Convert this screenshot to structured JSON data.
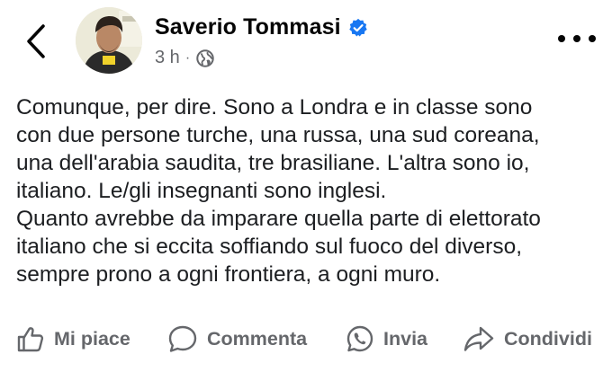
{
  "header": {
    "author_name": "Saverio Tommasi",
    "timestamp": "3 h",
    "separator": "·",
    "back_icon": "chevron-left-icon",
    "verified_icon": "verified-badge-icon",
    "privacy_icon": "globe-icon",
    "more_icon": "more-dots-icon"
  },
  "post": {
    "lines": [
      "Comunque, per dire. Sono a Londra e in classe sono",
      "con due persone turche, una russa, una sud coreana,",
      "una dell'arabia saudita, tre brasiliane. L'altra sono io,",
      "italiano. Le/gli insegnanti sono inglesi.",
      "Quanto avrebbe da imparare quella parte di elettorato",
      "italiano che si eccita soffiando sul fuoco del diverso,",
      "sempre prono a ogni frontiera, a ogni muro."
    ]
  },
  "actions": {
    "like_label": "Mi piace",
    "comment_label": "Commenta",
    "send_label": "Invia",
    "share_label": "Condividi"
  },
  "colors": {
    "text": "#050505",
    "secondary": "#65676b",
    "verified_blue": "#1877f2"
  }
}
